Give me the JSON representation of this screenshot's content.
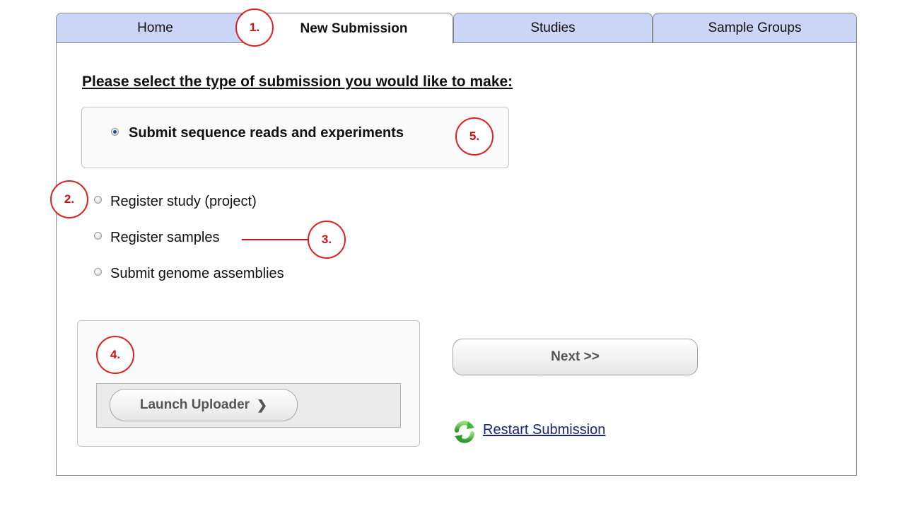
{
  "tabs": [
    {
      "label": "Home",
      "active": false
    },
    {
      "label": "New Submission",
      "active": true
    },
    {
      "label": "Studies",
      "active": false
    },
    {
      "label": "Sample Groups",
      "active": false
    }
  ],
  "heading": "Please select the type of submission you would like to make:",
  "options": [
    {
      "label": "Submit sequence reads and experiments",
      "selected": true
    },
    {
      "label": "Register study (project)",
      "selected": false
    },
    {
      "label": "Register samples",
      "selected": false
    },
    {
      "label": "Submit genome assemblies",
      "selected": false
    }
  ],
  "uploader": {
    "launch_label": "Launch Uploader",
    "chevron": "❯"
  },
  "next_label": "Next >>",
  "restart": {
    "label": "Restart Submission",
    "icon": "refresh-icon"
  },
  "callouts": [
    "1.",
    "2.",
    "3.",
    "4.",
    "5."
  ],
  "colors": {
    "tab_inactive": "#cbd5f5",
    "callout": "#e02020",
    "link": "#1a237e",
    "radio_selected": "#1f4f82"
  }
}
